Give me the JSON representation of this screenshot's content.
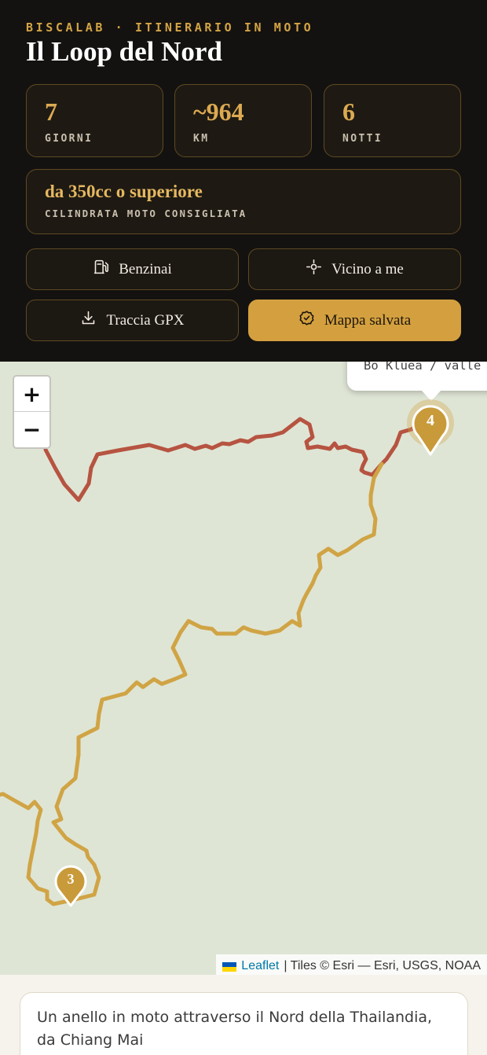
{
  "header": {
    "eyebrow": "BISCALAB · ITINERARIO IN MOTO",
    "title": "Il Loop del Nord"
  },
  "stats": [
    {
      "value": "7",
      "label": "GIORNI"
    },
    {
      "value": "~964",
      "label": "KM"
    },
    {
      "value": "6",
      "label": "NOTTI"
    }
  ],
  "engine": {
    "value": "da 350cc o superiore",
    "label": "CILINDRATA MOTO CONSIGLIATA"
  },
  "actions": {
    "fuel": {
      "label": "Benzinai",
      "icon": "fuel-pump-icon"
    },
    "near_me": {
      "label": "Vicino a me",
      "icon": "crosshair-icon"
    },
    "gpx": {
      "label": "Traccia GPX",
      "icon": "download-icon"
    },
    "saved": {
      "label": "Mappa salvata",
      "icon": "check-circle-icon"
    }
  },
  "map": {
    "zoom_in": "+",
    "zoom_out": "−",
    "popup_text": "Bo Kluea / valle",
    "markers": [
      {
        "number": "4"
      },
      {
        "number": "3"
      }
    ],
    "attribution": {
      "leaflet": "Leaflet",
      "tiles": "| Tiles © Esri — Esri, USGS, NOAA"
    },
    "colors": {
      "route_gold": "#d0a445",
      "route_red": "#b65441",
      "background": "#dfe5d5"
    }
  },
  "description": "Un anello in moto attraverso il Nord della Thailandia, da Chiang Mai",
  "colors": {
    "accent": "#d4a03f",
    "header_bg": "#141210"
  }
}
